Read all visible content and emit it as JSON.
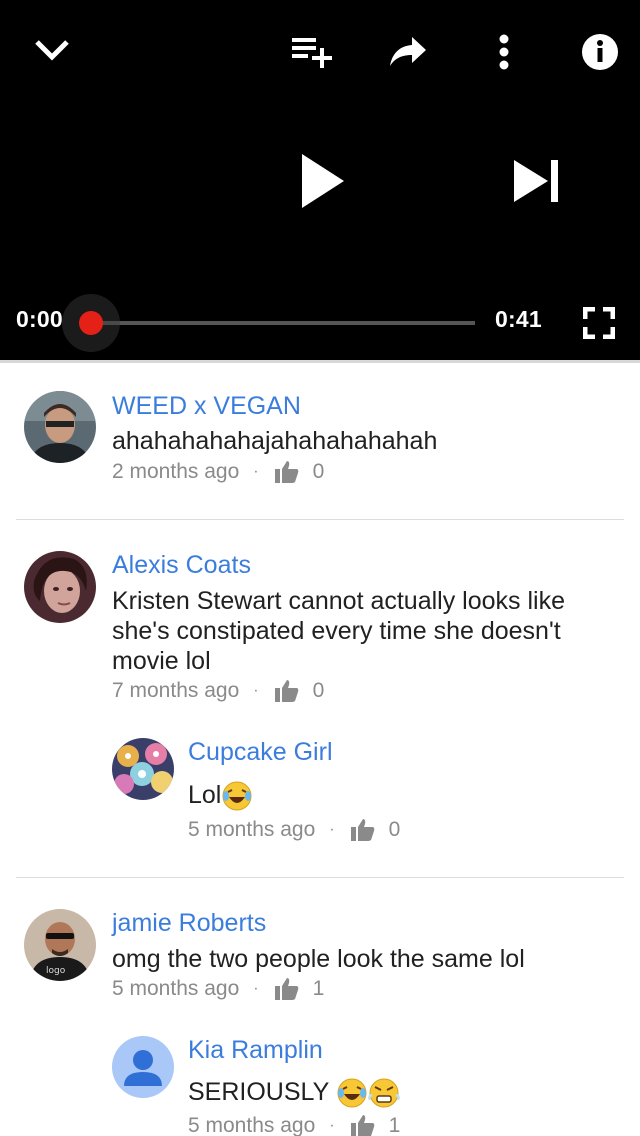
{
  "player": {
    "current_time": "0:00",
    "duration": "0:41",
    "progress": 0.0,
    "icons": [
      "chevron-down-icon",
      "add-to-playlist-icon",
      "share-icon",
      "more-vert-icon",
      "info-icon",
      "play-icon",
      "skip-next-icon",
      "fullscreen-icon"
    ]
  },
  "comments": [
    {
      "author": "WEED x VEGAN",
      "text": "ahahahahahajahahahahahah",
      "time": "2 months ago",
      "likes": "0",
      "replies": []
    },
    {
      "author": "Alexis Coats",
      "text": "Kristen Stewart cannot actually looks like she's constipated every time she doesn't movie lol",
      "time": "7 months ago",
      "likes": "0",
      "replies": [
        {
          "author": "Cupcake Girl",
          "text": "Lol",
          "time": "5 months ago",
          "likes": "0"
        }
      ]
    },
    {
      "author": "jamie Roberts",
      "text": "omg the two people look the same lol",
      "time": "5 months ago",
      "likes": "1",
      "replies": [
        {
          "author": "Kia Ramplin",
          "text": "SERIOUSLY",
          "time": "5 months ago",
          "likes": "1"
        }
      ]
    }
  ],
  "colors": {
    "accent_red": "#e52117",
    "link_blue": "#3b7ddd",
    "meta_gray": "#8a8a8a"
  }
}
